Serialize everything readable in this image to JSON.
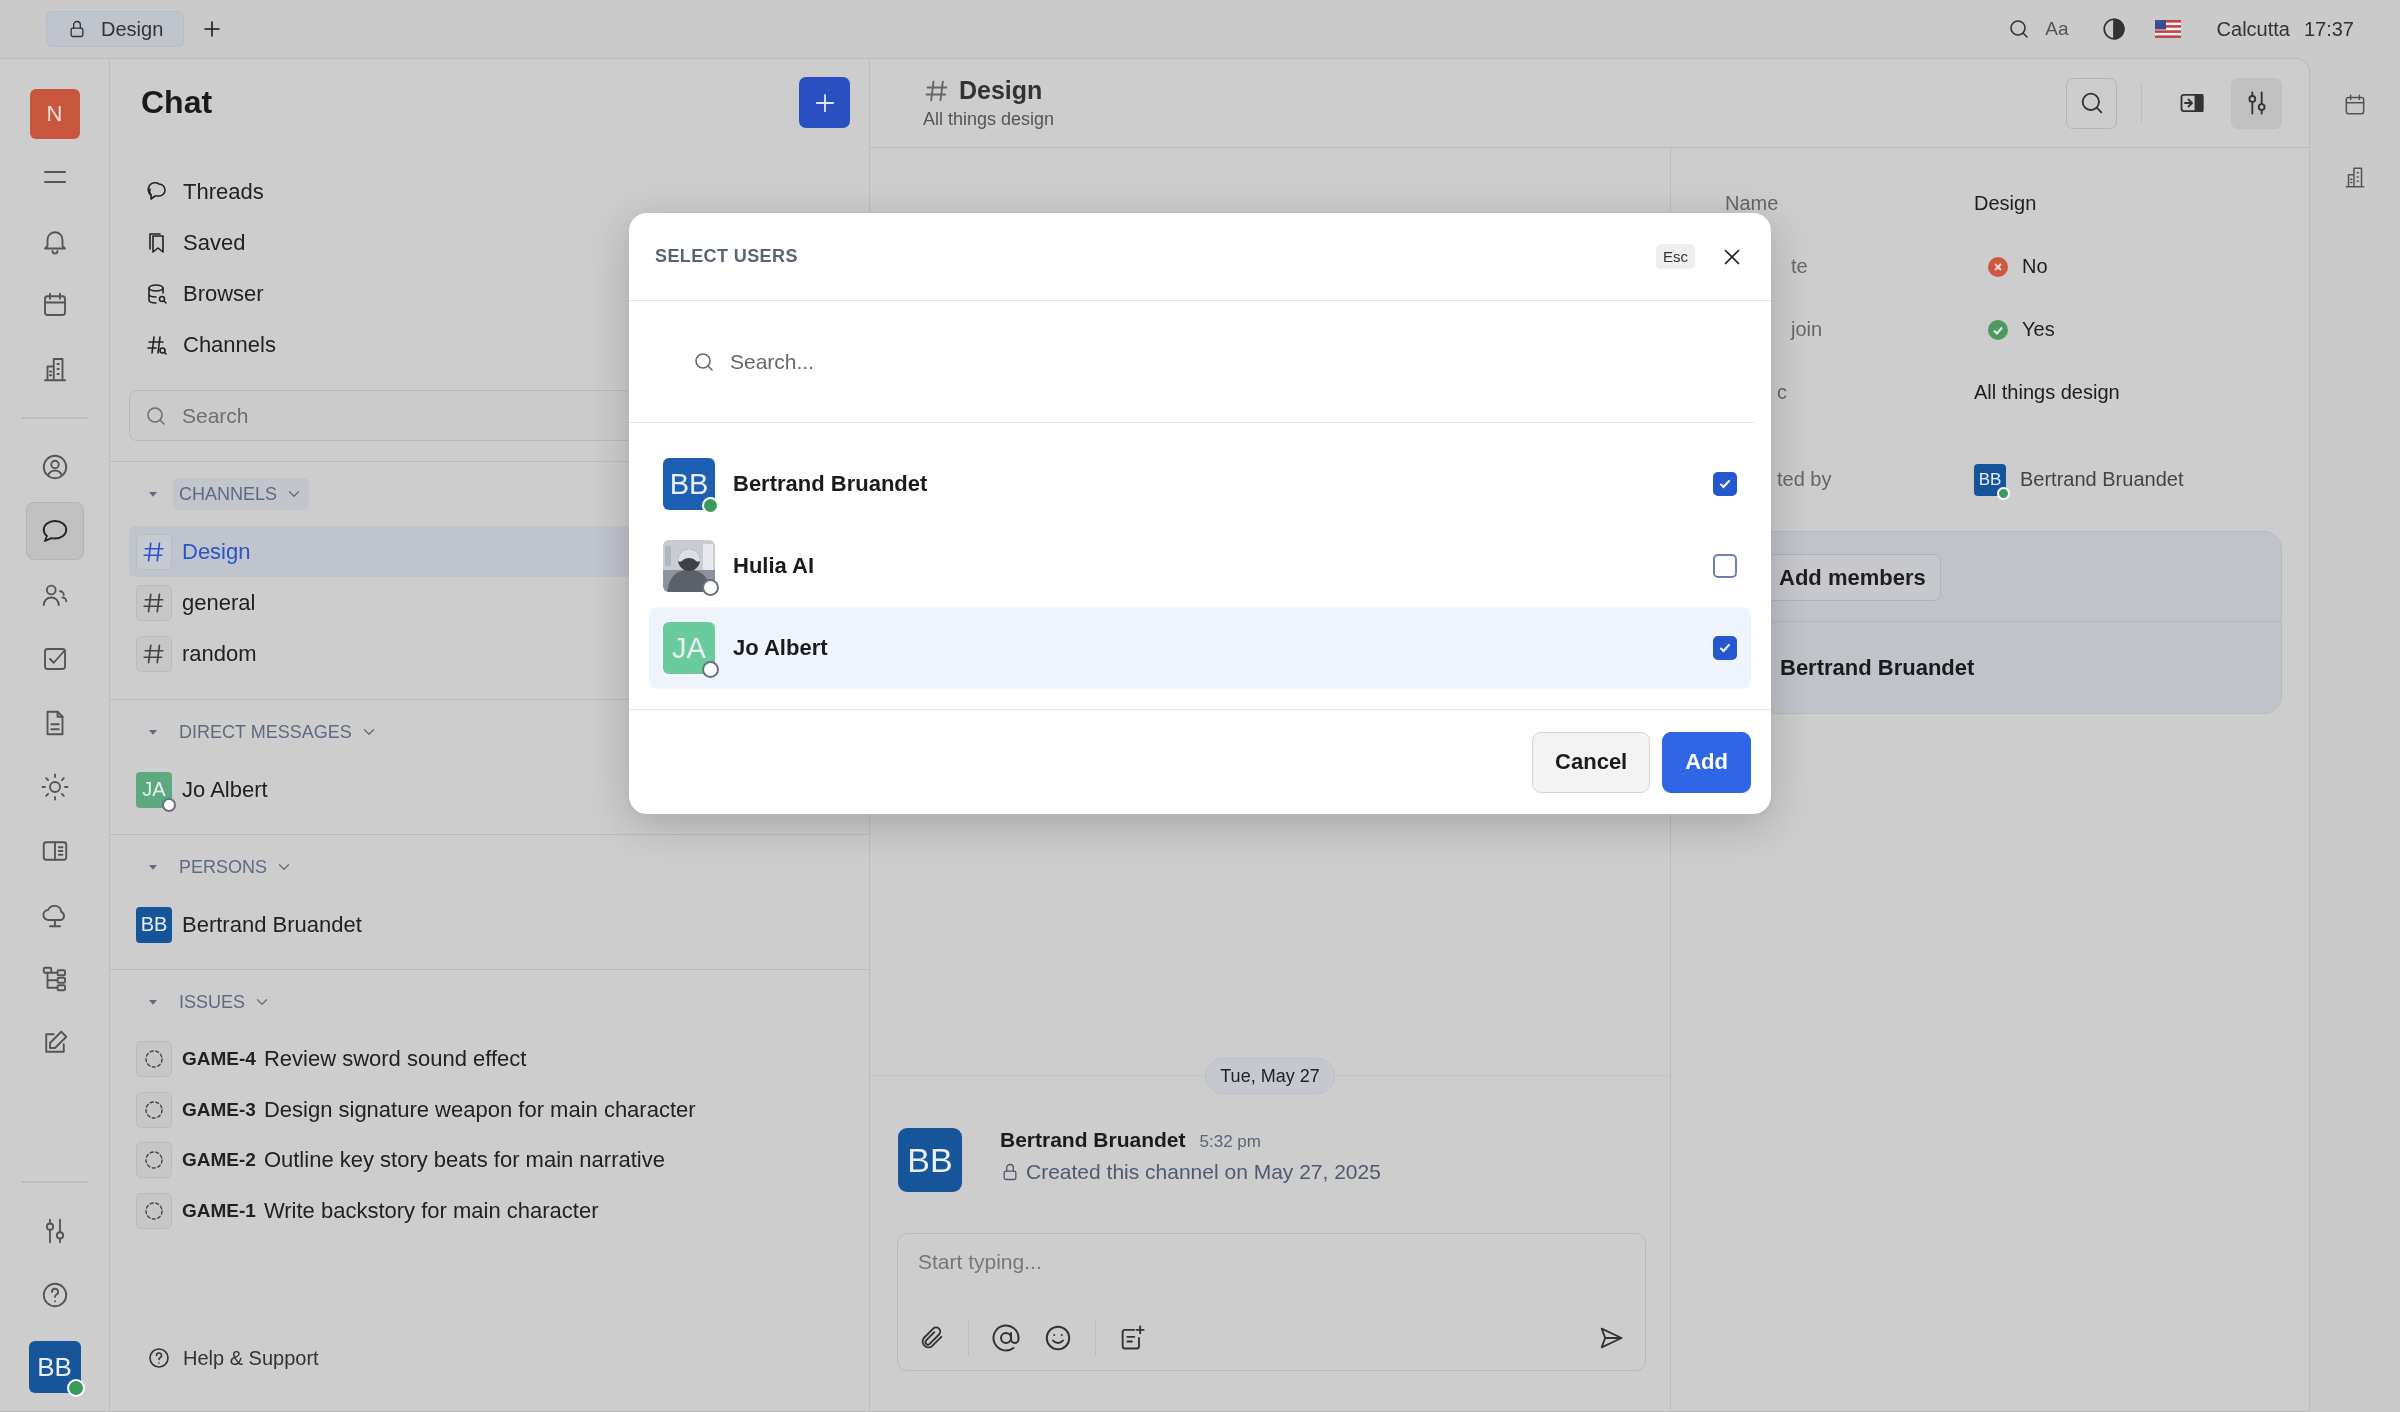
{
  "top_bar": {
    "tab": {
      "label": "Design",
      "selected": true
    },
    "font_button": "Aa",
    "location": "Calcutta",
    "time": "17:37"
  },
  "rail": {
    "workspace": "N",
    "items": [
      {
        "selected": false
      },
      {
        "selected": false
      },
      {
        "selected": false
      },
      {
        "selected": false
      },
      {
        "selected": false
      },
      {
        "selected": true
      },
      {
        "selected": false
      },
      {
        "selected": false
      },
      {
        "selected": false
      },
      {
        "selected": false
      },
      {
        "selected": false
      },
      {
        "selected": false
      },
      {
        "selected": false
      },
      {
        "selected": false
      },
      {
        "selected": false
      },
      {
        "selected": false
      }
    ],
    "user": {
      "initials": "BB",
      "color": "#17559a",
      "online": true
    }
  },
  "sidebar": {
    "title": "Chat",
    "nav": [
      {
        "label": "Threads"
      },
      {
        "label": "Saved"
      },
      {
        "label": "Browser"
      },
      {
        "label": "Channels"
      }
    ],
    "search": {
      "placeholder": "Search"
    },
    "sections": [
      {
        "kind": "channels",
        "title": "CHANNELS",
        "items": [
          {
            "name": "Design",
            "selected": true
          },
          {
            "name": "general",
            "selected": false
          },
          {
            "name": "random",
            "selected": false
          }
        ]
      },
      {
        "kind": "people",
        "title": "DIRECT MESSAGES",
        "items": [
          {
            "name": "Jo Albert",
            "initials": "JA",
            "color": "#5daa80",
            "online": false
          }
        ]
      },
      {
        "kind": "people",
        "title": "PERSONS",
        "items": [
          {
            "name": "Bertrand Bruandet",
            "initials": "BB",
            "color": "#17559a"
          }
        ]
      },
      {
        "kind": "issues",
        "title": "ISSUES",
        "items": [
          {
            "id": "GAME-4",
            "title": "Review sword sound effect"
          },
          {
            "id": "GAME-3",
            "title": "Design signature weapon for main character"
          },
          {
            "id": "GAME-2",
            "title": "Outline key story beats for main narrative"
          },
          {
            "id": "GAME-1",
            "title": "Write backstory for main character"
          }
        ]
      }
    ],
    "help": "Help & Support"
  },
  "channel": {
    "name": "Design",
    "topic": "All things design",
    "toolbar": [
      {
        "selected": false
      },
      {
        "selected": false
      },
      {
        "selected": true
      }
    ],
    "date": "Tue, May 27",
    "message": {
      "author": "Bertrand Bruandet",
      "initials": "BB",
      "color": "#17559a",
      "time": "5:32 pm",
      "text": "Created this channel on May 27, 2025"
    },
    "composer": {
      "placeholder": "Start typing..."
    }
  },
  "details": {
    "rows": [
      {
        "kind": "text",
        "label": "Name",
        "value": "Design"
      },
      {
        "kind": "flag",
        "label": "te",
        "value": "No",
        "on": false
      },
      {
        "kind": "flag",
        "label": "join",
        "value": "Yes",
        "on": true
      },
      {
        "kind": "text",
        "label": "c",
        "value": "All things design"
      },
      {
        "kind": "person",
        "label": "ted by",
        "value": "Bertrand Bruandet",
        "initials": "BB",
        "color": "#17559a",
        "online": true
      }
    ],
    "add_members": "Add members",
    "members": [
      {
        "name": "Bertrand Bruandet"
      }
    ]
  },
  "dialog": {
    "title": "SELECT USERS",
    "esc": "Esc",
    "search": {
      "placeholder": "Search..."
    },
    "users": [
      {
        "kind": "initials",
        "name": "Bertrand Bruandet",
        "initials": "BB",
        "color": "#1d5fb3",
        "online": true,
        "checked": true,
        "selected": false
      },
      {
        "kind": "picture",
        "name": "Hulia AI",
        "online": false,
        "checked": false,
        "selected": false
      },
      {
        "kind": "initials",
        "name": "Jo Albert",
        "initials": "JA",
        "color": "#6acb9c",
        "online": false,
        "checked": true,
        "selected": true
      }
    ],
    "buttons": [
      {
        "kind": "secondary",
        "label": "Cancel"
      },
      {
        "kind": "primary",
        "label": "Add"
      }
    ]
  }
}
